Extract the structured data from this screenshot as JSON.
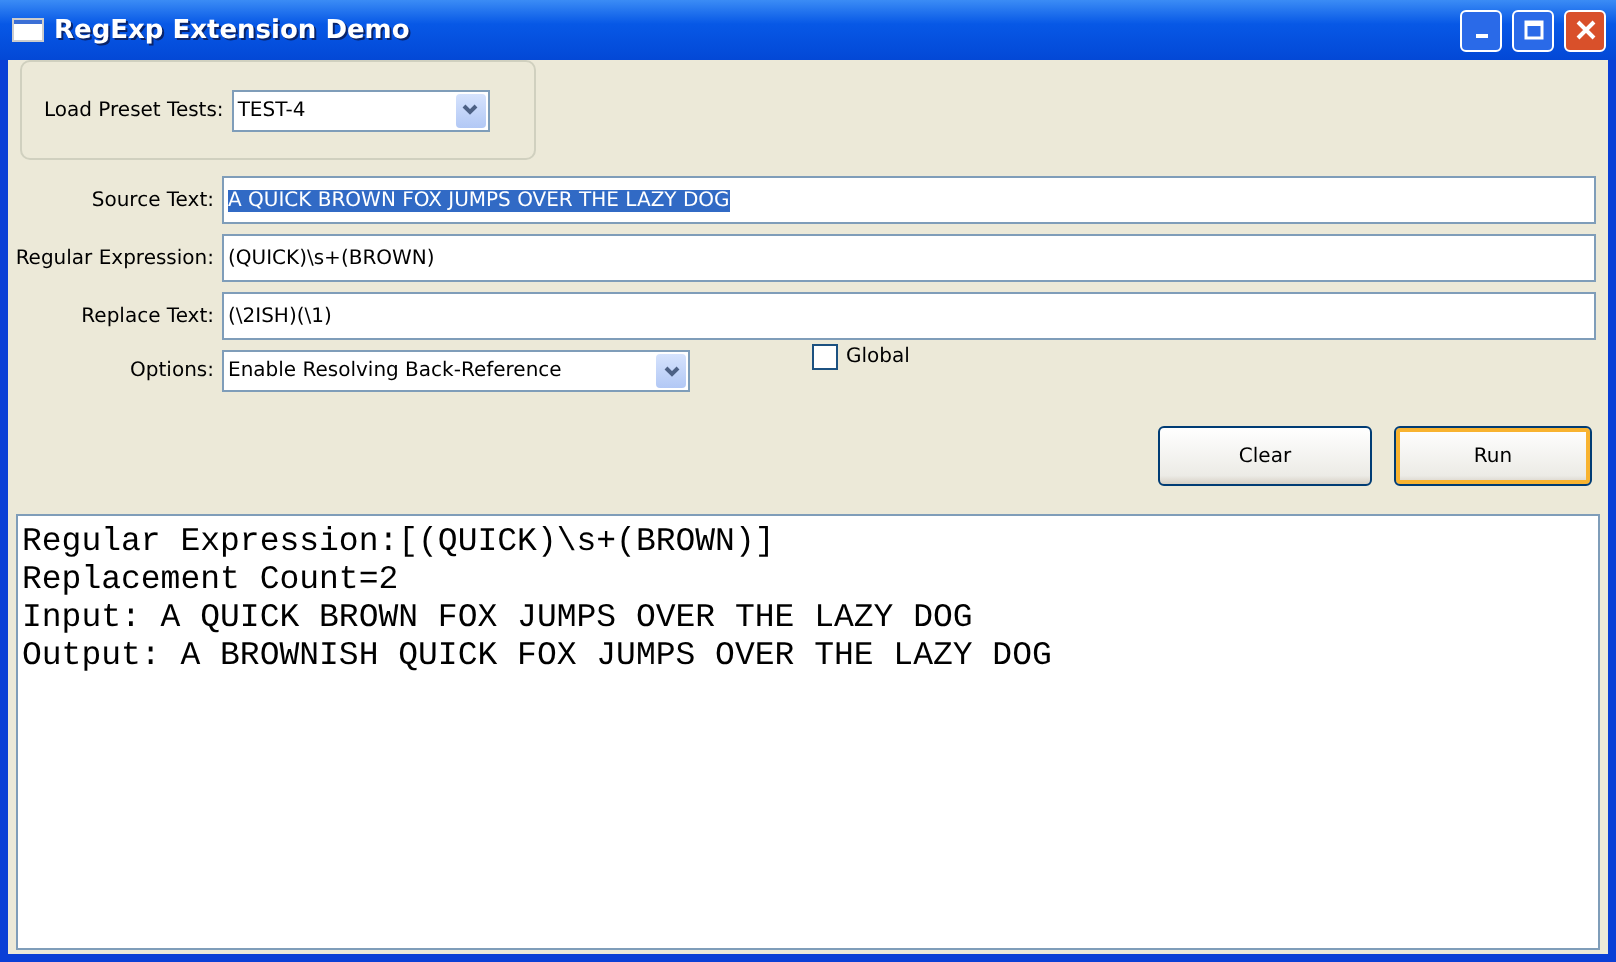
{
  "window": {
    "title": "RegExp Extension Demo"
  },
  "preset": {
    "label": "Load Preset Tests:",
    "value": "TEST-4"
  },
  "fields": [
    {
      "label": "Source Text:",
      "value": "A QUICK BROWN FOX JUMPS OVER THE LAZY DOG",
      "highlighted": true
    },
    {
      "label": "Regular Expression:",
      "value": "(QUICK)\\s+(BROWN)",
      "highlighted": false
    },
    {
      "label": "Replace Text:",
      "value": "(\\2ISH)(\\1)",
      "highlighted": false
    }
  ],
  "options": {
    "label": "Options:",
    "value": "Enable Resolving Back-Reference"
  },
  "global": {
    "label": "Global",
    "checked": false
  },
  "buttons": [
    {
      "label": "Clear",
      "default": false
    },
    {
      "label": "Run",
      "default": true
    }
  ],
  "output": [
    "Regular Expression:[(QUICK)\\s+(BROWN)]",
    "Replacement Count=2",
    "Input: A QUICK BROWN FOX JUMPS OVER THE LAZY DOG",
    "Output: A BROWNISH QUICK FOX JUMPS OVER THE LAZY DOG"
  ]
}
